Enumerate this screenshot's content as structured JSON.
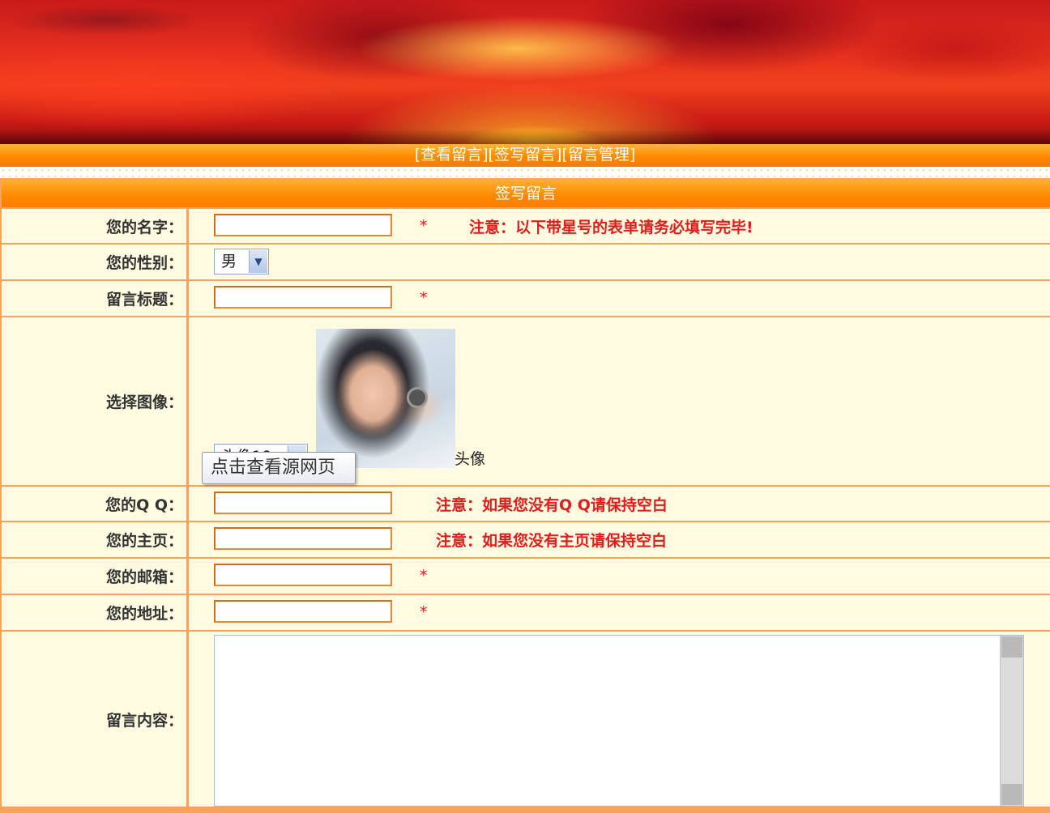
{
  "nav": {
    "view": "[查看留言]",
    "sign": "[签写留言]",
    "manage": "[留言管理]"
  },
  "form": {
    "title": "签写留言",
    "required_mark": "*",
    "name": {
      "label": "您的名字：",
      "value": ""
    },
    "notice_required": "注意：以下带星号的表单请务必填写完毕!",
    "gender": {
      "label": "您的性别：",
      "selected": "男"
    },
    "subject": {
      "label": "留言标题：",
      "value": ""
    },
    "avatar": {
      "label": "选择图像：",
      "selected": "头像10",
      "caption": "头像",
      "tooltip": "点击查看源网页"
    },
    "qq": {
      "label": "您的Q Q：",
      "value": "",
      "note": "注意：如果您没有Q Q请保持空白"
    },
    "homepage": {
      "label": "您的主页：",
      "value": "",
      "note": "注意：如果您没有主页请保持空白"
    },
    "email": {
      "label": "您的邮箱：",
      "value": ""
    },
    "address": {
      "label": "您的地址：",
      "value": ""
    },
    "content": {
      "label": "留言内容：",
      "value": ""
    }
  },
  "colors": {
    "accent_orange": "#ff8a00",
    "row_bg": "#fffbe0",
    "grid_line": "#f7a35c",
    "required_red": "#e31b1b"
  }
}
